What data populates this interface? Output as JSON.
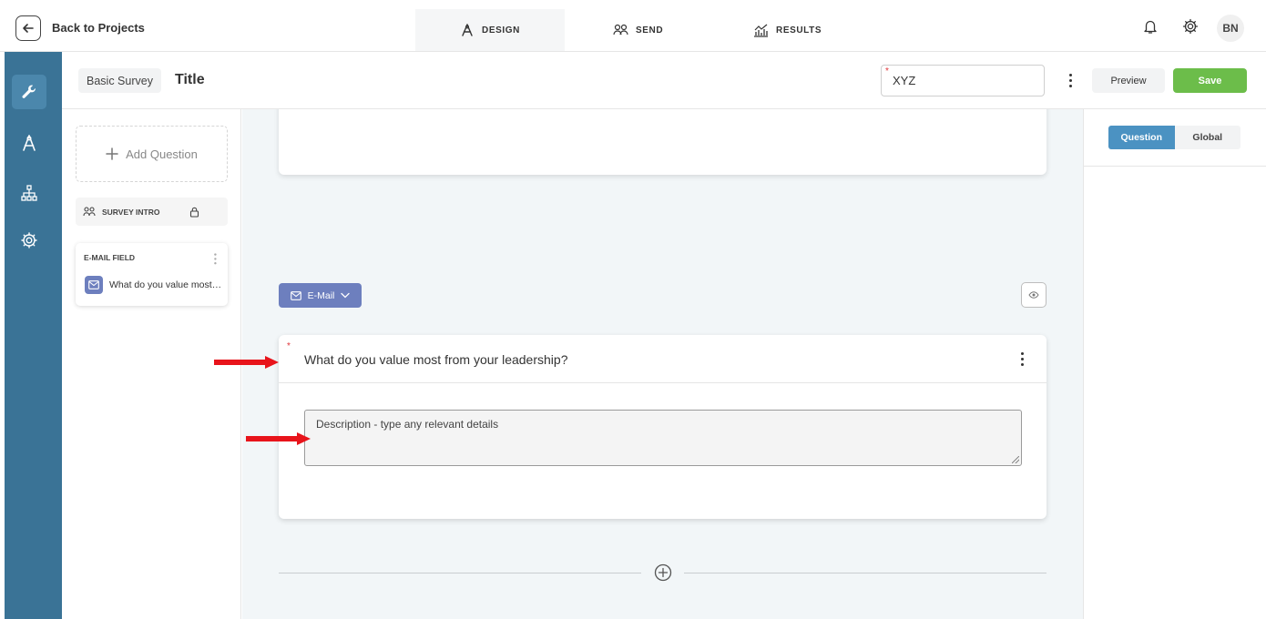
{
  "topbar": {
    "back_label": "Back to Projects",
    "tabs": [
      {
        "label": "DESIGN",
        "icon": "compass-icon",
        "active": true
      },
      {
        "label": "SEND",
        "icon": "users-icon",
        "active": false
      },
      {
        "label": "RESULTS",
        "icon": "chart-icon",
        "active": false
      }
    ],
    "avatar_initials": "BN"
  },
  "rail": {
    "items": [
      {
        "icon": "wrench-icon",
        "active": true
      },
      {
        "icon": "compass-icon",
        "active": false
      },
      {
        "icon": "sitemap-icon",
        "active": false
      },
      {
        "icon": "gear-icon",
        "active": false
      }
    ]
  },
  "subheader": {
    "type_label": "Basic Survey",
    "title": "Title",
    "name_value": "XYZ",
    "preview_label": "Preview",
    "save_label": "Save"
  },
  "left_panel": {
    "add_question_label": "Add Question",
    "intro_label": "SURVEY INTRO",
    "question_card": {
      "type_label": "E-MAIL FIELD",
      "text": "What do you value most from your leadership?"
    }
  },
  "canvas": {
    "type_dropdown_label": "E-Mail",
    "question_title": "What do you value most from your leadership?",
    "description_placeholder": "Description - type any relevant details"
  },
  "right_panel": {
    "tabs": [
      {
        "label": "Question",
        "active": true
      },
      {
        "label": "Global",
        "active": false
      }
    ]
  },
  "colors": {
    "rail": "#3a7396",
    "accent_blue": "#4b92c2",
    "save_green": "#6cbd4a",
    "type_purple": "#6d7fbe",
    "annotation_red": "#e8141b"
  }
}
